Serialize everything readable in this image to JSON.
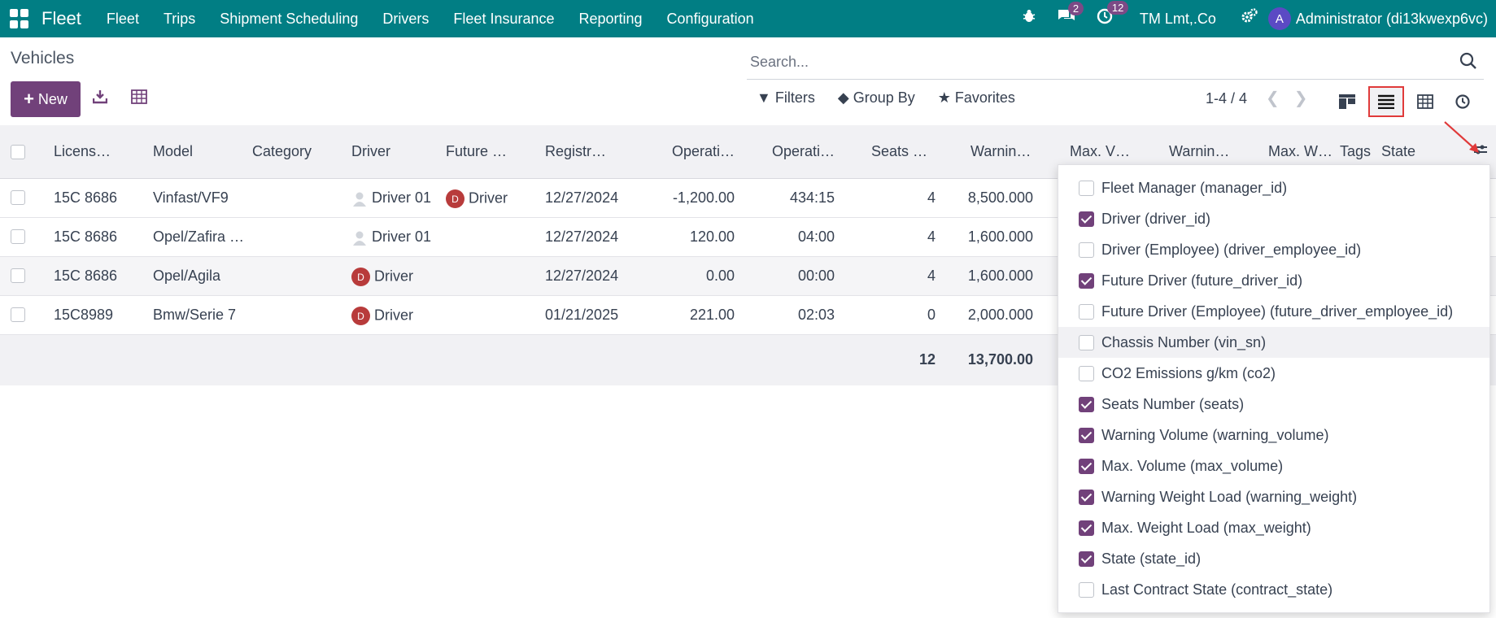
{
  "topbar": {
    "brand": "Fleet",
    "menu": [
      "Fleet",
      "Trips",
      "Shipment Scheduling",
      "Drivers",
      "Fleet Insurance",
      "Reporting",
      "Configuration"
    ],
    "messages_count": "2",
    "activities_count": "12",
    "company": "TM Lmt,.Co",
    "avatar_letter": "A",
    "user": "Administrator (di13kwexp6vc)"
  },
  "breadcrumb": "Vehicles",
  "toolbar": {
    "new_label": "New"
  },
  "search": {
    "placeholder": "Search..."
  },
  "filters": {
    "filters_label": "Filters",
    "groupby_label": "Group By",
    "favorites_label": "Favorites"
  },
  "pager": "1-4 / 4",
  "columns": [
    "Licens…",
    "Model",
    "Category",
    "Driver",
    "Future …",
    "Registr…",
    "Operati…",
    "Operati…",
    "Seats …",
    "Warnin…",
    "Max. V…",
    "Warnin…",
    "Max. W…",
    "Tags",
    "State"
  ],
  "rows": [
    {
      "license": "15C 8686",
      "model": "Vinfast/VF9",
      "driver": "Driver 01",
      "driver_avatar": "person",
      "future_driver": "Driver",
      "future_badge": "D",
      "registration": "12/27/2024",
      "odometer": "-1,200.00",
      "hours": "434:15",
      "seats": "4",
      "warning_volume": "8,500.000"
    },
    {
      "license": "15C 8686",
      "model": "Opel/Zafira …",
      "driver": "Driver 01",
      "driver_avatar": "person",
      "future_driver": "",
      "future_badge": "",
      "registration": "12/27/2024",
      "odometer": "120.00",
      "hours": "04:00",
      "seats": "4",
      "warning_volume": "1,600.000"
    },
    {
      "license": "15C 8686",
      "model": "Opel/Agila",
      "driver": "Driver",
      "driver_avatar": "D",
      "future_driver": "",
      "future_badge": "",
      "registration": "12/27/2024",
      "odometer": "0.00",
      "hours": "00:00",
      "seats": "4",
      "warning_volume": "1,600.000"
    },
    {
      "license": "15C8989",
      "model": "Bmw/Serie 7",
      "driver": "Driver",
      "driver_avatar": "D",
      "future_driver": "",
      "future_badge": "",
      "registration": "01/21/2025",
      "odometer": "221.00",
      "hours": "02:03",
      "seats": "0",
      "warning_volume": "2,000.000"
    }
  ],
  "totals": {
    "seats": "12",
    "warning_volume": "13,700.00"
  },
  "optional_columns": [
    {
      "label": "Fleet Manager (manager_id)",
      "checked": false
    },
    {
      "label": "Driver (driver_id)",
      "checked": true
    },
    {
      "label": "Driver (Employee) (driver_employee_id)",
      "checked": false
    },
    {
      "label": "Future Driver (future_driver_id)",
      "checked": true
    },
    {
      "label": "Future Driver (Employee) (future_driver_employee_id)",
      "checked": false
    },
    {
      "label": "Chassis Number (vin_sn)",
      "checked": false
    },
    {
      "label": "CO2 Emissions g/km (co2)",
      "checked": false
    },
    {
      "label": "Seats Number (seats)",
      "checked": true
    },
    {
      "label": "Warning Volume (warning_volume)",
      "checked": true
    },
    {
      "label": "Max. Volume (max_volume)",
      "checked": true
    },
    {
      "label": "Warning Weight Load (warning_weight)",
      "checked": true
    },
    {
      "label": "Max. Weight Load (max_weight)",
      "checked": true
    },
    {
      "label": "State (state_id)",
      "checked": true
    },
    {
      "label": "Last Contract State (contract_state)",
      "checked": false
    }
  ],
  "colors": {
    "topbar": "#017e84",
    "primary": "#71417a",
    "badge": "#7c4a86",
    "driver_badge": "#b83b3b",
    "highlight": "#e03a3a"
  }
}
